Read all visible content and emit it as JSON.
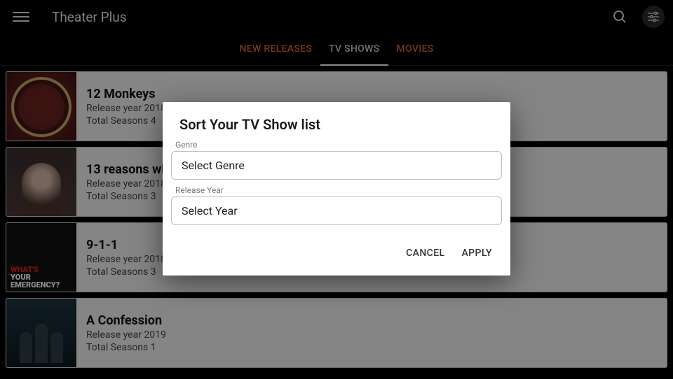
{
  "app": {
    "title": "Theater Plus"
  },
  "tabs": {
    "new_releases": "NEW RELEASES",
    "tv_shows": "TV SHOWS",
    "movies": "MOVIES"
  },
  "shows": [
    {
      "title": "12 Monkeys",
      "year_line": "Release year 2018",
      "seasons_line": "Total Seasons 4"
    },
    {
      "title": "13 reasons why",
      "year_line": "Release year 2018",
      "seasons_line": "Total Seasons 3"
    },
    {
      "title": "9-1-1",
      "year_line": "Release year 2018",
      "seasons_line": "Total Seasons 3"
    },
    {
      "title": "A Confession",
      "year_line": "Release year 2019",
      "seasons_line": "Total Seasons 1"
    }
  ],
  "thumb3": {
    "line1": "WHAT'S",
    "line2": "YOUR",
    "line3": "EMERGENCY?"
  },
  "dialog": {
    "title": "Sort Your TV Show list",
    "genre_label": "Genre",
    "genre_value": "Select Genre",
    "year_label": "Release Year",
    "year_value": "Select Year",
    "cancel": "CANCEL",
    "apply": "APPLY"
  }
}
